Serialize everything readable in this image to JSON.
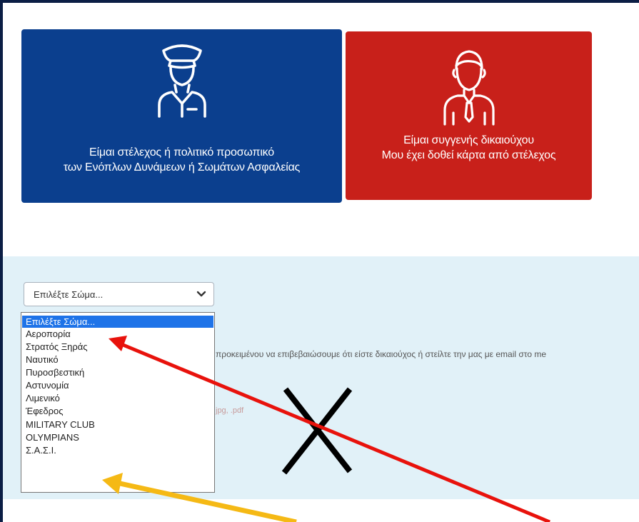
{
  "cards": {
    "military": {
      "line1": "Είμαι στέλεχος ή πολιτικό προσωπικό",
      "line2": "των Ενόπλων Δυνάμεων ή Σωμάτων Ασφαλείας",
      "icon": "officer-icon",
      "color": "#0b3f8e"
    },
    "relative": {
      "line1": "Είμαι συγγενής δικαιούχου",
      "line2": "Μου έχει δοθεί κάρτα από στέλεχος",
      "icon": "person-tie-icon",
      "color": "#c8201a"
    }
  },
  "corps_select": {
    "value": "Επιλέξτε Σώμα...",
    "options": [
      "Επιλέξτε Σώμα...",
      "Αεροπορία",
      "Στρατός Ξηράς",
      "Ναυτικό",
      "Πυροσβεστική",
      "Αστυνομία",
      "Λιμενικό",
      "Έφεδρος",
      "MILITARY CLUB",
      "OLYMPIANS",
      "Σ.Α.Σ.Ι."
    ],
    "highlighted_index": 0
  },
  "background_text": {
    "instructions": "προκειμένου να επιβεβαιώσουμε ότι είστε δικαιούχος ή στείλτε την μας με email στο me",
    "fragment": "jpg, .pdf"
  },
  "annotations": {
    "red_arrow_color": "#e8120c",
    "yellow_arrow_color": "#f5b915",
    "cross_color": "#000000"
  }
}
